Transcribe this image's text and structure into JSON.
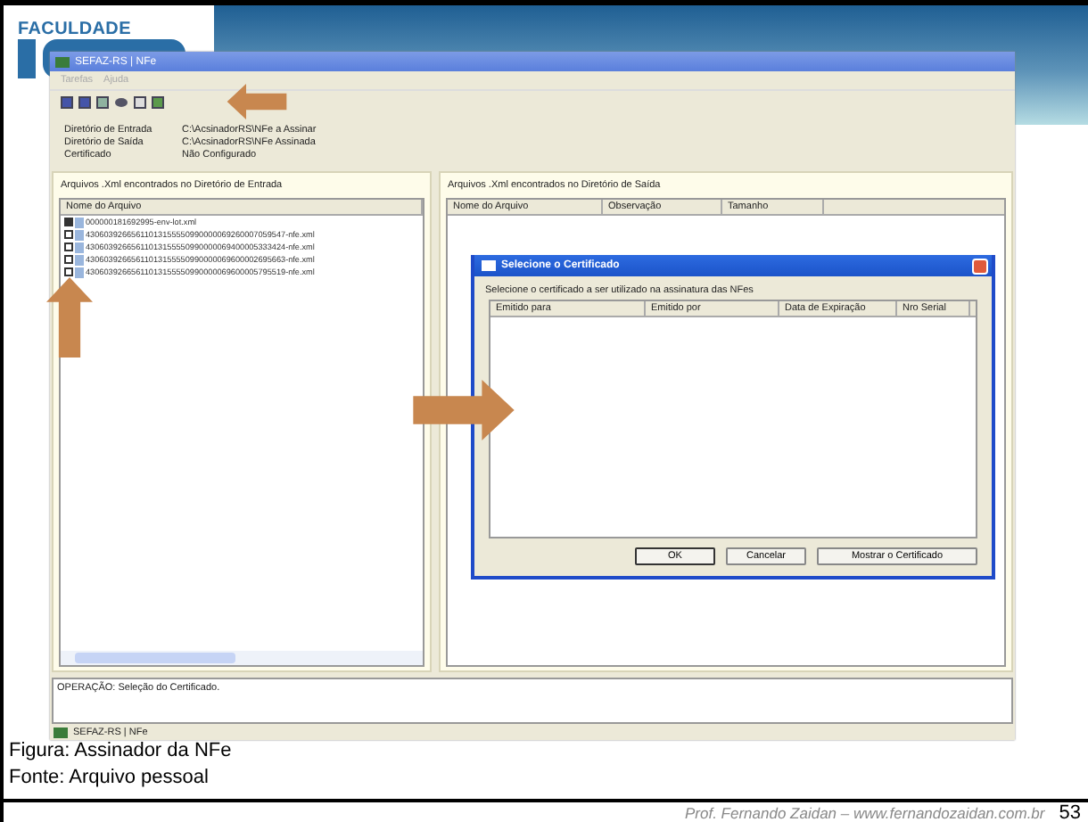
{
  "logo": {
    "text": "FACULDADE"
  },
  "window": {
    "title": "SEFAZ-RS | NFe",
    "menu": [
      "Tarefas",
      "Ajuda"
    ],
    "info": [
      {
        "label": "Diretório de Entrada",
        "value": "C:\\AcsinadorRS\\NFe a Assinar"
      },
      {
        "label": "Diretório de Saída",
        "value": "C:\\AcsinadorRS\\NFe Assinada"
      },
      {
        "label": "Certificado",
        "value": "Não Configurado"
      }
    ],
    "input_panel": {
      "title": "Arquivos .Xml encontrados no Diretório de Entrada",
      "column": "Nome do Arquivo",
      "files": [
        {
          "name": "000000181692995-env-lot.xml",
          "checked": true
        },
        {
          "name": "43060392665611013155550990000069260007059547-nfe.xml",
          "checked": false
        },
        {
          "name": "43060392665611013155550990000069400005333424-nfe.xml",
          "checked": false
        },
        {
          "name": "43060392665611013155550990000069600002695663-nfe.xml",
          "checked": false
        },
        {
          "name": "43060392665611013155550990000069600005795519-nfe.xml",
          "checked": false
        }
      ]
    },
    "output_panel": {
      "title": "Arquivos .Xml encontrados no Diretório de Saída",
      "columns": [
        "Nome do Arquivo",
        "Observação",
        "Tamanho"
      ]
    },
    "dialog": {
      "title": "Selecione o Certificado",
      "prompt": "Selecione o certificado a ser utilizado na assinatura das NFes",
      "columns": [
        "Emitido para",
        "Emitido por",
        "Data de Expiração",
        "Nro Serial"
      ],
      "buttons": [
        "OK",
        "Cancelar",
        "Mostrar o Certificado"
      ]
    },
    "status": "OPERAÇÃO: Seleção do Certificado.",
    "taskbar": "SEFAZ-RS | NFe"
  },
  "caption": [
    "Figura: Assinador da NFe",
    "Fonte: Arquivo pessoal"
  ],
  "footer": {
    "author": "Prof. Fernando Zaidan – www.fernandozaidan.com.br",
    "page": "53"
  }
}
